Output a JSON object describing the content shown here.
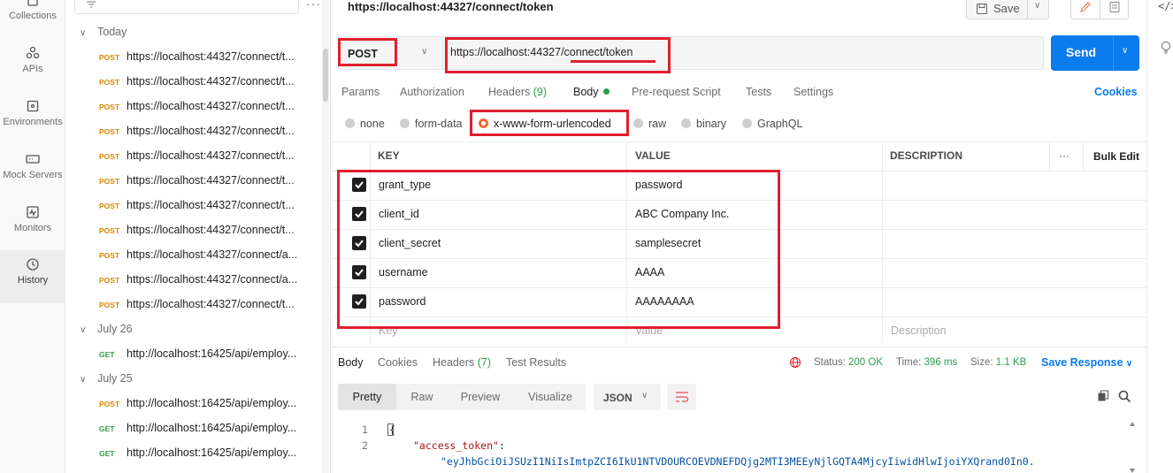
{
  "rail": {
    "items": [
      {
        "label": "Collections",
        "icon": "collections-icon"
      },
      {
        "label": "APIs",
        "icon": "apis-icon"
      },
      {
        "label": "Environments",
        "icon": "environments-icon"
      },
      {
        "label": "Mock Servers",
        "icon": "mock-servers-icon"
      },
      {
        "label": "Monitors",
        "icon": "monitors-icon"
      },
      {
        "label": "History",
        "icon": "history-icon",
        "active": true
      }
    ]
  },
  "sidebar": {
    "more": "···",
    "groups": [
      {
        "label": "Today"
      },
      {
        "label": "July 26"
      },
      {
        "label": "July 25"
      }
    ],
    "today": [
      {
        "method": "POST",
        "url": "https://localhost:44327/connect/t..."
      },
      {
        "method": "POST",
        "url": "https://localhost:44327/connect/t..."
      },
      {
        "method": "POST",
        "url": "https://localhost:44327/connect/t..."
      },
      {
        "method": "POST",
        "url": "https://localhost:44327/connect/t..."
      },
      {
        "method": "POST",
        "url": "https://localhost:44327/connect/t..."
      },
      {
        "method": "POST",
        "url": "https://localhost:44327/connect/t..."
      },
      {
        "method": "POST",
        "url": "https://localhost:44327/connect/t..."
      },
      {
        "method": "POST",
        "url": "https://localhost:44327/connect/t..."
      },
      {
        "method": "POST",
        "url": "https://localhost:44327/connect/a..."
      },
      {
        "method": "POST",
        "url": "https://localhost:44327/connect/a..."
      },
      {
        "method": "POST",
        "url": "https://localhost:44327/connect/t..."
      }
    ],
    "july26": [
      {
        "method": "GET",
        "url": "http://localhost:16425/api/employ..."
      }
    ],
    "july25": [
      {
        "method": "POST",
        "url": "http://localhost:16425/api/employ..."
      },
      {
        "method": "GET",
        "url": "http://localhost:16425/api/employ..."
      },
      {
        "method": "GET",
        "url": "http://localhost:16425/api/employ..."
      }
    ]
  },
  "header": {
    "title": "https://localhost:44327/connect/token",
    "save_label": "Save"
  },
  "request": {
    "method": "POST",
    "url": "https://localhost:44327/connect/token",
    "send_label": "Send"
  },
  "tabs": {
    "params": "Params",
    "authorization": "Authorization",
    "headers": "Headers",
    "headers_count": "(9)",
    "body": "Body",
    "prerequest": "Pre-request Script",
    "tests": "Tests",
    "settings": "Settings",
    "cookies": "Cookies"
  },
  "body_options": {
    "none": "none",
    "form_data": "form-data",
    "urlencoded": "x-www-form-urlencoded",
    "raw": "raw",
    "binary": "binary",
    "graphql": "GraphQL",
    "selected": "x-www-form-urlencoded"
  },
  "params_table": {
    "headers": {
      "key": "KEY",
      "value": "VALUE",
      "description": "DESCRIPTION",
      "more": "···",
      "bulk_edit": "Bulk Edit"
    },
    "rows": [
      {
        "key": "grant_type",
        "value": "password",
        "checked": true
      },
      {
        "key": "client_id",
        "value": "ABC Company Inc.",
        "checked": true
      },
      {
        "key": "client_secret",
        "value": "samplesecret",
        "checked": true
      },
      {
        "key": "username",
        "value": "AAAA",
        "checked": true
      },
      {
        "key": "password",
        "value": "AAAAAAAA",
        "checked": true
      }
    ],
    "placeholders": {
      "key": "Key",
      "value": "Value",
      "description": "Description"
    }
  },
  "response": {
    "tabs": {
      "body": "Body",
      "cookies": "Cookies",
      "headers": "Headers",
      "headers_count": "(7)",
      "test_results": "Test Results"
    },
    "status_label": "Status:",
    "status_value": "200 OK",
    "time_label": "Time:",
    "time_value": "396 ms",
    "size_label": "Size:",
    "size_value": "1.1 KB",
    "save_response": "Save Response",
    "views": [
      "Pretty",
      "Raw",
      "Preview",
      "Visualize"
    ],
    "active_view": "Pretty",
    "format": "JSON",
    "lines": [
      {
        "num": "1",
        "text": "{"
      },
      {
        "num": "2",
        "key": "\"access_token\"",
        "sep": ":"
      }
    ],
    "token_value": "\"eyJhbGciOiJSUzI1NiIsImtpZCI6IkU1NTVDOURCOEVDNEFDQjg2MTI3MEEyNjlGQTA4MjcyIiwidHlwIjoiYXQrand0In0."
  },
  "colors": {
    "accent": "#097bed",
    "post": "#d88900",
    "get": "#2d9d4e",
    "highlight": "#e0202e",
    "radio_selected": "#f26b3a"
  }
}
